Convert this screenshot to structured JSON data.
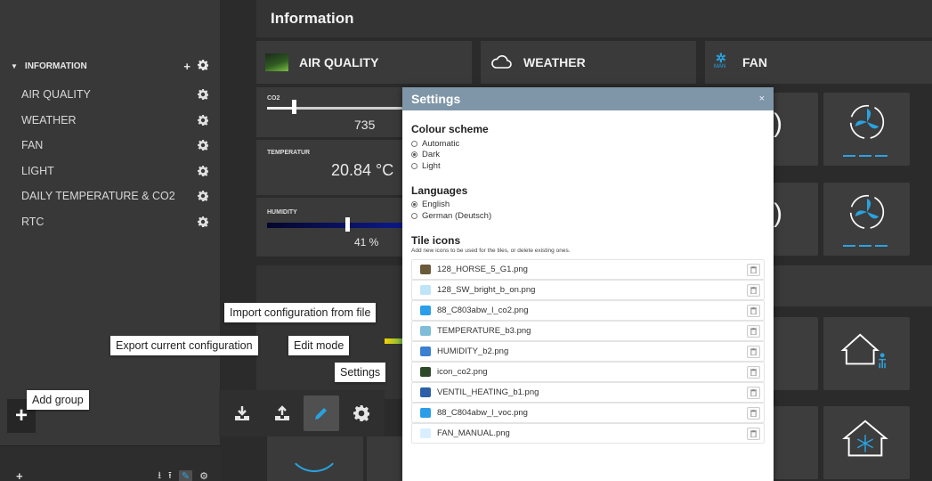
{
  "sidebar": {
    "group_label": "INFORMATION",
    "items": [
      {
        "label": "AIR QUALITY"
      },
      {
        "label": "WEATHER"
      },
      {
        "label": "FAN"
      },
      {
        "label": "LIGHT"
      },
      {
        "label": "DAILY TEMPERATURE & CO2"
      },
      {
        "label": "RTC"
      }
    ]
  },
  "page": {
    "title": "Information"
  },
  "tiles": {
    "air_quality": "AIR QUALITY",
    "weather": "WEATHER",
    "fan": "FAN",
    "fan_badge": "MAN"
  },
  "sensors": {
    "co2_label": "CO2",
    "co2_value": "735",
    "co2_level": 0.2,
    "temperature_label": "TEMPERATUR",
    "temperature_value": "20.84 °C",
    "humidity_label": "HUMIDITY",
    "humidity_value": "41 %",
    "humidity_level": 0.63
  },
  "settings": {
    "title": "Settings",
    "close": "×",
    "colour_scheme": {
      "title": "Colour scheme",
      "options": [
        "Automatic",
        "Dark",
        "Light"
      ],
      "selected": "Dark"
    },
    "languages": {
      "title": "Languages",
      "options": [
        "English",
        "German (Deutsch)"
      ],
      "selected": "English"
    },
    "tile_icons": {
      "title": "Tile icons",
      "hint": "Add new icons to be used for the tiles, or delete existing ones.",
      "files": [
        {
          "name": "128_HORSE_5_G1.png",
          "color": "#6b5a3a"
        },
        {
          "name": "128_SW_bright_b_on.png",
          "color": "#bfe4f7"
        },
        {
          "name": "88_C803abw_l_co2.png",
          "color": "#2a9ee8"
        },
        {
          "name": "TEMPERATURE_b3.png",
          "color": "#7fbcd8"
        },
        {
          "name": "HUMIDITY_b2.png",
          "color": "#3b7fd1"
        },
        {
          "name": "icon_co2.png",
          "color": "#2e4a2a"
        },
        {
          "name": "VENTIL_HEATING_b1.png",
          "color": "#2c5fa8"
        },
        {
          "name": "88_C804abw_l_voc.png",
          "color": "#2a9ee8"
        },
        {
          "name": "FAN_MANUAL.png",
          "color": "#d9efff"
        }
      ]
    }
  },
  "tooltips": {
    "import": "Import configuration from file",
    "export": "Export current configuration",
    "edit": "Edit mode",
    "settings": "Settings",
    "add_group": "Add group"
  },
  "colors": {
    "accent": "#29a3e0",
    "modal_header": "#7f96a8"
  }
}
